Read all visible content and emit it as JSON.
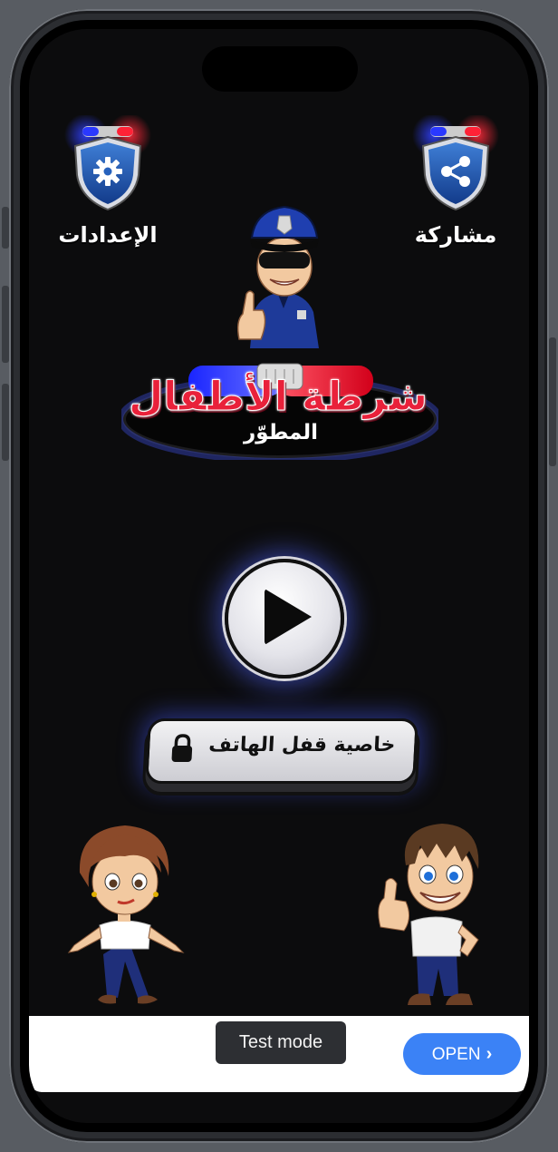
{
  "header": {
    "settings_label": "الإعدادات",
    "share_label": "مشاركة",
    "settings_icon": "gear-icon",
    "share_icon": "share-icon"
  },
  "logo": {
    "title": "شرطة الأطفال",
    "subtitle": "المطوّر"
  },
  "main": {
    "play_icon": "play-icon",
    "lock_button_label": "خاصية قفل الهاتف",
    "lock_icon": "lock-icon"
  },
  "ad": {
    "test_mode_label": "Test mode",
    "open_label": "OPEN",
    "open_icon": "chevron-right-icon"
  },
  "colors": {
    "background": "#0c0c0d",
    "logo_red": "#e9213a",
    "siren_blue": "#2c3dff",
    "ad_button_blue": "#3b82f6"
  }
}
